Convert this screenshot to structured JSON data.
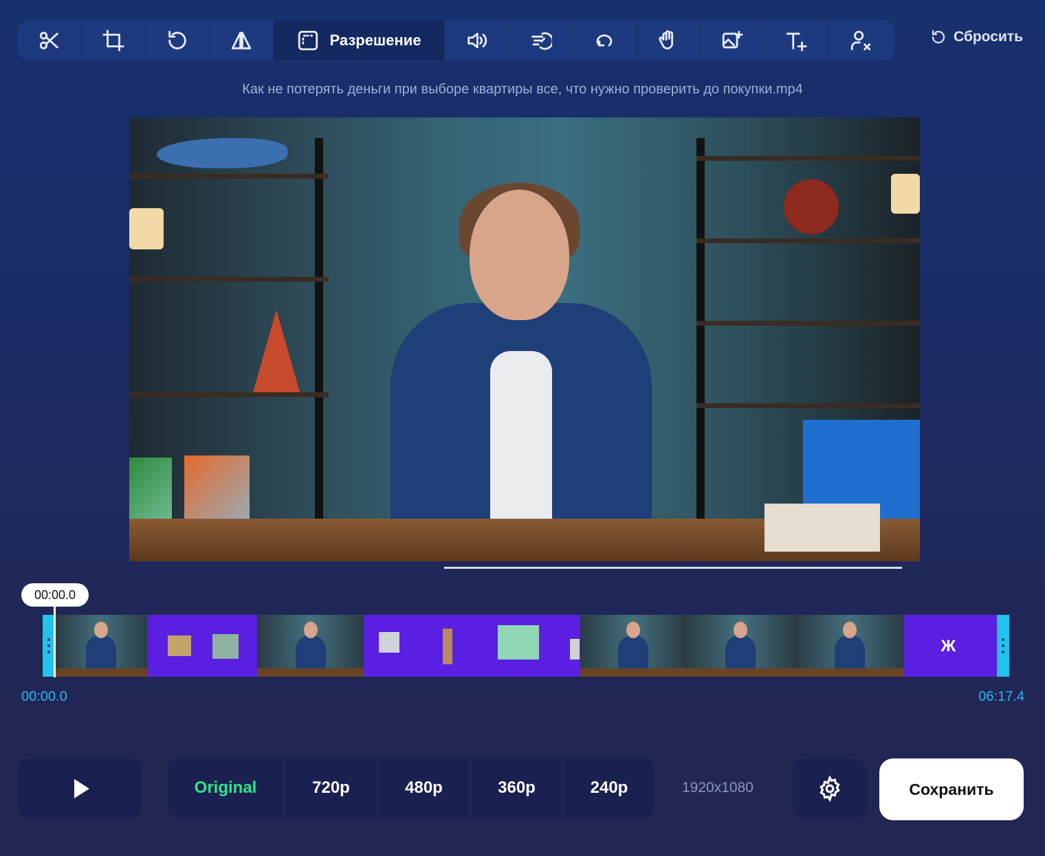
{
  "toolbar": {
    "tools": [
      {
        "name": "scissors-icon"
      },
      {
        "name": "crop-icon"
      },
      {
        "name": "rotate-icon"
      },
      {
        "name": "flip-icon"
      },
      {
        "name": "resolution-icon",
        "label": "Разрешение",
        "active": true
      },
      {
        "name": "volume-icon"
      },
      {
        "name": "speed-icon"
      },
      {
        "name": "loop-icon"
      },
      {
        "name": "stabilize-icon"
      },
      {
        "name": "add-image-icon"
      },
      {
        "name": "add-text-icon"
      },
      {
        "name": "remove-person-icon"
      }
    ],
    "reset_label": "Сбросить"
  },
  "filename": "Как не потерять деньги при выборе квартиры все, что нужно проверить до покупки.mp4",
  "timeline": {
    "current_time": "00:00.0",
    "start_time": "00:00.0",
    "end_time": "06:17.4"
  },
  "resolution": {
    "options": [
      "Original",
      "720p",
      "480p",
      "360p",
      "240p"
    ],
    "selected": "Original",
    "dimensions": "1920x1080"
  },
  "save_label": "Сохранить",
  "colors": {
    "accent_selected": "#2ee68a",
    "timeline_handle": "#22c3ee",
    "time_text": "#2bb6ee"
  }
}
